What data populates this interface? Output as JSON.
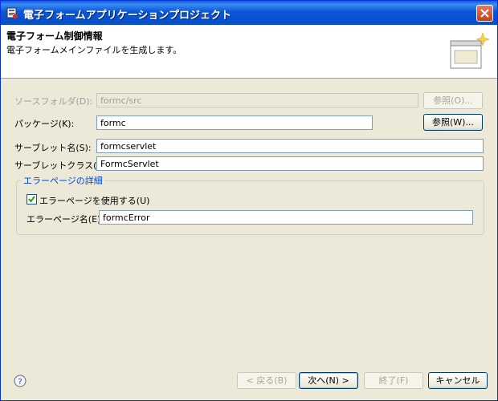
{
  "window": {
    "title": "電子フォームアプリケーションプロジェクト"
  },
  "banner": {
    "title": "電子フォーム制御情報",
    "description": "電子フォームメインファイルを生成します。"
  },
  "form": {
    "source_folder": {
      "label": "ソースフォルダ(D):",
      "value": "formc/src",
      "browse": "参照(O)..."
    },
    "package": {
      "label": "パッケージ(K):",
      "value": "formc",
      "browse": "参照(W)..."
    },
    "servlet_name": {
      "label": "サーブレット名(S):",
      "value": "formcservlet"
    },
    "servlet_class": {
      "label": "サーブレットクラス(C):",
      "value": "FormcServlet"
    }
  },
  "error_group": {
    "title": "エラーページの詳細",
    "use_error_page": {
      "label": "エラーページを使用する(U)",
      "checked": true
    },
    "error_page_name": {
      "label": "エラーページ名(E):",
      "value": "formcError"
    }
  },
  "footer": {
    "back": "< 戻る(B)",
    "next": "次へ(N) >",
    "finish": "終了(F)",
    "cancel": "キャンセル"
  },
  "colors": {
    "title_bar": "#0a57d6",
    "dialog_bg": "#ece9d8",
    "group_title": "#0046d5"
  }
}
